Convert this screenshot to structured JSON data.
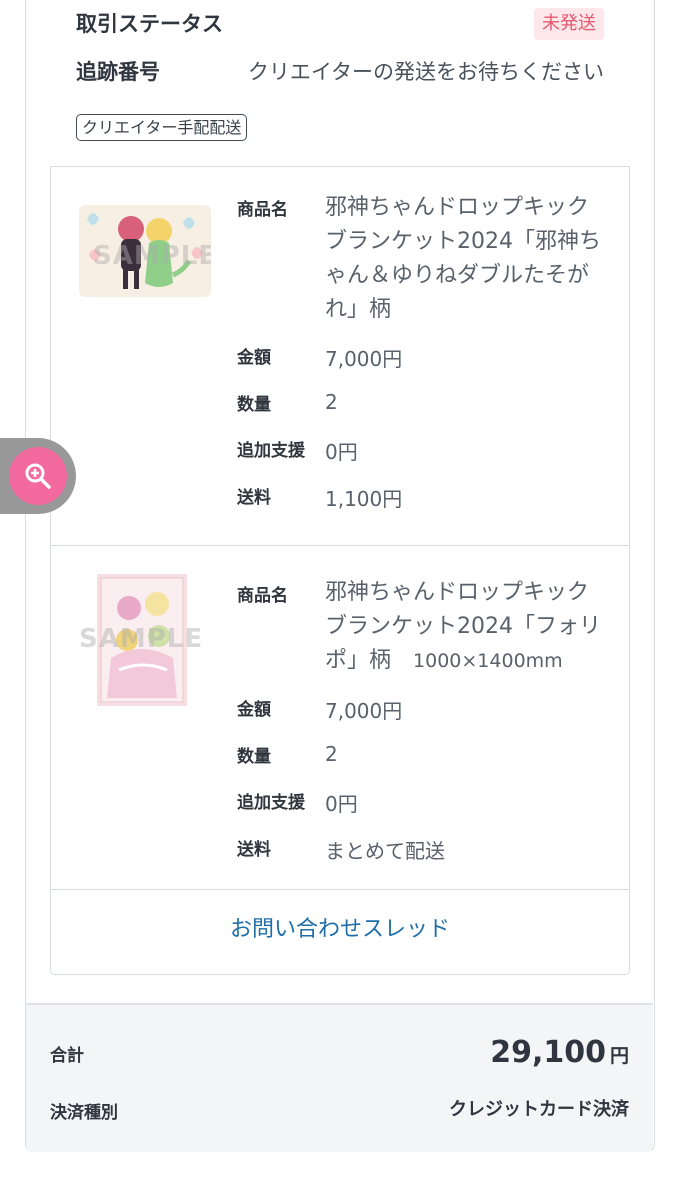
{
  "order": {
    "status_label": "取引ステータス",
    "status_badge": "未発送",
    "tracking_label": "追跡番号",
    "tracking_value": "クリエイターの発送をお待ちください",
    "shipping_tag": "クリエイター手配配送"
  },
  "items": [
    {
      "name_label": "商品名",
      "name_line1": "邪神ちゃんドロップキック",
      "name_line2": "ブランケット2024「邪神ち",
      "name_line3": "ゃん＆ゆりねダブルたそが",
      "name_line4": "れ」柄",
      "price_label": "金額",
      "price": "7,000円",
      "qty_label": "数量",
      "qty": "2",
      "support_label": "追加支援",
      "support": "0円",
      "shipping_label": "送料",
      "shipping": "1,100円",
      "thumbnail_watermark": "SAMPLE"
    },
    {
      "name_label": "商品名",
      "name_line1": "邪神ちゃんドロップキック",
      "name_line2": "ブランケット2024「フォリ",
      "name_line3": "ポ」柄",
      "name_size": "1000×1400mm",
      "price_label": "金額",
      "price": "7,000円",
      "qty_label": "数量",
      "qty": "2",
      "support_label": "追加支援",
      "support": "0円",
      "shipping_label": "送料",
      "shipping": "まとめて配送",
      "thumbnail_watermark": "SAMPLE"
    }
  ],
  "inquiry_link": "お問い合わせスレッド",
  "summary": {
    "total_label": "合計",
    "total_amount": "29,100",
    "total_unit": "円",
    "payment_label": "決済種別",
    "payment_value": "クレジットカード決済"
  },
  "zoom": {
    "icon": "zoom-in-icon"
  },
  "colors": {
    "badge_bg": "#fde7ea",
    "badge_text": "#e5596f",
    "link": "#1f6ea8",
    "zoom_button": "#f26a9e",
    "summary_bg": "#f3f5f7"
  }
}
